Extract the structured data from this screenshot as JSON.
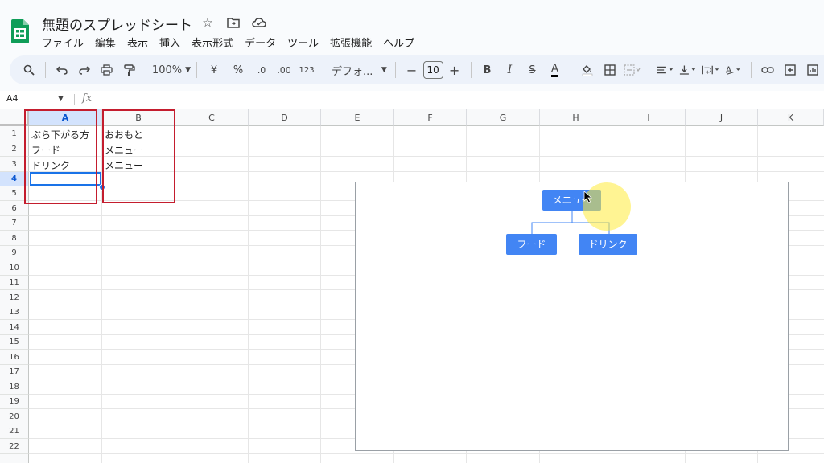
{
  "app": {
    "doc_title": "無題のスプレッドシート",
    "menu": [
      "ファイル",
      "編集",
      "表示",
      "挿入",
      "表示形式",
      "データ",
      "ツール",
      "拡張機能",
      "ヘルプ"
    ]
  },
  "toolbar": {
    "zoom": "100%",
    "currency": "¥",
    "percent": "%",
    "dec_decrease": ".0",
    "dec_increase": ".00",
    "number_format": "123",
    "font": "デフォ...",
    "font_size": "10",
    "bold": "B",
    "italic": "I",
    "strike": "S",
    "text_color": "A"
  },
  "formula_bar": {
    "cell_ref": "A4",
    "fx": "fx"
  },
  "sheet": {
    "columns": [
      "A",
      "B",
      "C",
      "D",
      "E",
      "F",
      "G",
      "H",
      "I",
      "J",
      "K"
    ],
    "rows": [
      "1",
      "2",
      "3",
      "4",
      "5",
      "6",
      "7",
      "8",
      "9",
      "10",
      "11",
      "12",
      "13",
      "14",
      "15",
      "16",
      "17",
      "18",
      "19",
      "20",
      "21",
      "22"
    ],
    "cells": {
      "A1": "ぶら下がる方",
      "A2": "フード",
      "A3": "ドリンク",
      "B1": "おおもと",
      "B2": "メニュー",
      "B3": "メニュー"
    },
    "selected_cell": "A4"
  },
  "org_chart": {
    "root": "メニュー",
    "children": [
      "フード",
      "ドリンク"
    ]
  },
  "colors": {
    "accent": "#1a73e8",
    "node": "#4285f4",
    "annotation": "#c41d2e",
    "sheets_green": "#0f9d58"
  }
}
